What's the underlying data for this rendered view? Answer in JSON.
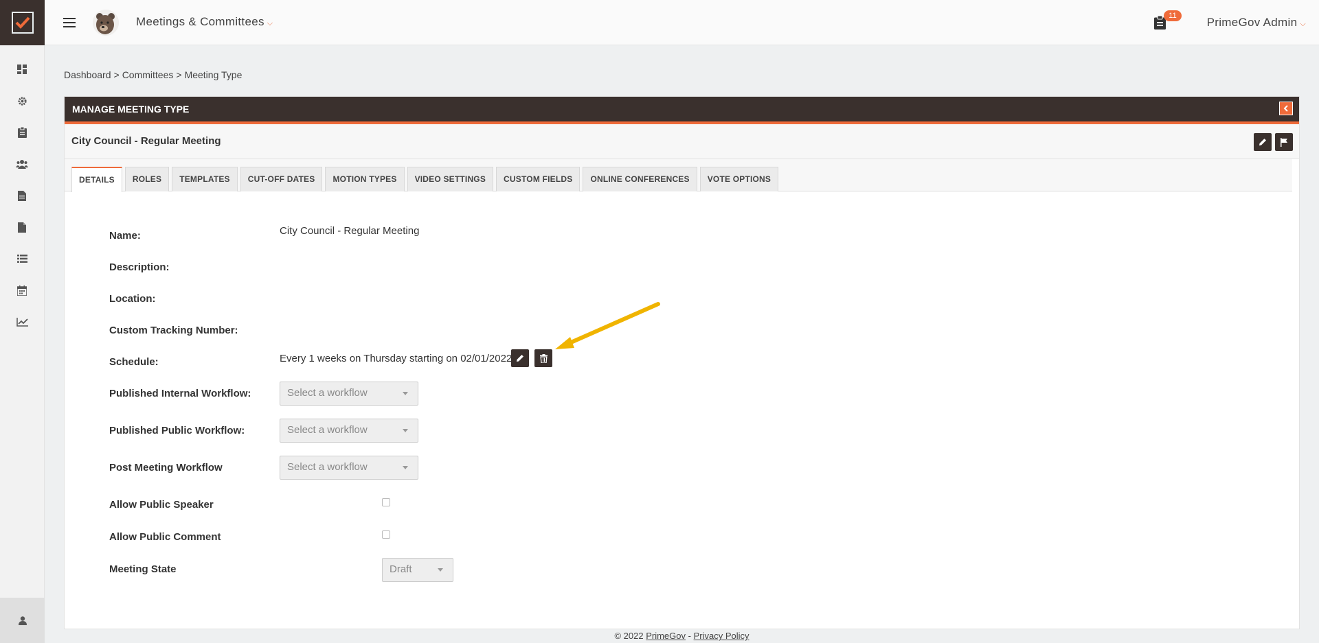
{
  "topbar": {
    "module_title": "Meetings & Committees",
    "notification_count": "11",
    "user_name": "PrimeGov Admin"
  },
  "breadcrumb": {
    "items": [
      "Dashboard",
      "Committees",
      "Meeting Type"
    ],
    "separator": ">"
  },
  "panel": {
    "title": "MANAGE MEETING TYPE",
    "record_title": "City Council - Regular Meeting"
  },
  "tabs": [
    {
      "label": "DETAILS",
      "active": true
    },
    {
      "label": "ROLES"
    },
    {
      "label": "TEMPLATES"
    },
    {
      "label": "CUT-OFF DATES"
    },
    {
      "label": "MOTION TYPES"
    },
    {
      "label": "VIDEO SETTINGS"
    },
    {
      "label": "CUSTOM FIELDS"
    },
    {
      "label": "ONLINE CONFERENCES"
    },
    {
      "label": "VOTE OPTIONS"
    }
  ],
  "form": {
    "name_label": "Name:",
    "name_value": "City Council - Regular Meeting",
    "description_label": "Description:",
    "location_label": "Location:",
    "tracking_label": "Custom Tracking Number:",
    "schedule_label": "Schedule:",
    "schedule_value": "Every 1 weeks on Thursday starting on 02/01/2022",
    "internal_workflow_label": "Published Internal Workflow:",
    "public_workflow_label": "Published Public Workflow:",
    "post_workflow_label": "Post Meeting Workflow",
    "workflow_placeholder": "Select a workflow",
    "public_speaker_label": "Allow Public Speaker",
    "public_comment_label": "Allow Public Comment",
    "meeting_state_label": "Meeting State",
    "meeting_state_value": "Draft"
  },
  "footer": {
    "copyright": "© 2022",
    "brand_link": "PrimeGov",
    "dash": "-",
    "privacy_link": "Privacy Policy"
  },
  "colors": {
    "accent": "#ef6b3a",
    "dark": "#3a302d",
    "annotation_arrow": "#f0b400"
  }
}
